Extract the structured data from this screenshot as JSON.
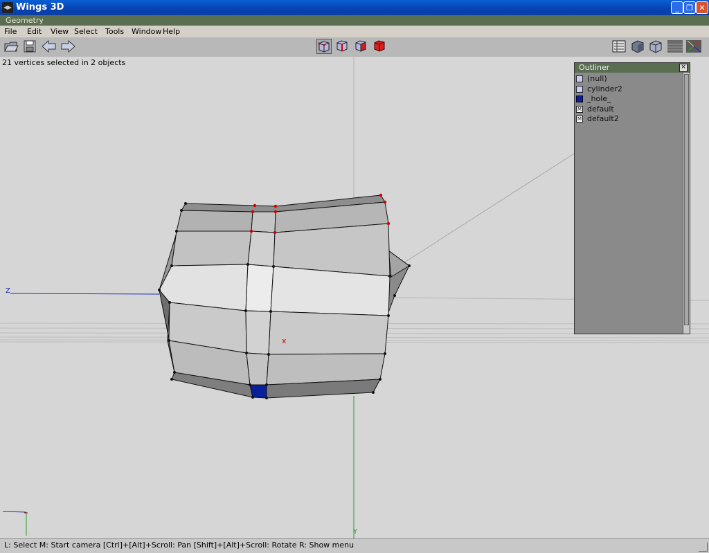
{
  "window": {
    "title": "Wings 3D",
    "minimize": "_",
    "restore": "❐",
    "close": "✕"
  },
  "geometry_tab": "Geometry",
  "menu": [
    "File",
    "Edit",
    "View",
    "Select",
    "Tools",
    "Window",
    "Help"
  ],
  "toolbar": {
    "left": [
      "open-icon",
      "save-icon",
      "undo-icon",
      "redo-icon"
    ],
    "select_modes": [
      "vertex-mode-icon",
      "edge-mode-icon",
      "face-mode-icon",
      "body-mode-icon"
    ],
    "right": [
      "workmode-icon",
      "smooth-shade-icon",
      "flat-shade-icon",
      "ground-grid-icon",
      "axes-icon"
    ]
  },
  "viewport": {
    "status": "21 vertices selected in 2 objects",
    "axis_z_label": "Z",
    "axis_y_label": "Y",
    "origin_marker": "x",
    "colors": {
      "face": "#bdbdbd",
      "light_face": "#e0e0e0",
      "dark_face": "#7a7a7a",
      "hole_face": "#0a1f9a",
      "selected_vertex": "#cc0000",
      "z_axis": "#1a2ab8",
      "y_axis": "#2a9a2a"
    }
  },
  "outliner": {
    "title": "Outliner",
    "close": "×",
    "items": [
      {
        "label": "(null)",
        "icon": "object-cube-icon"
      },
      {
        "label": "cylinder2",
        "icon": "object-cube-icon"
      },
      {
        "label": "_hole_",
        "icon": "hole-material-icon"
      },
      {
        "label": "default",
        "icon": "material-icon"
      },
      {
        "label": "default2",
        "icon": "material-icon"
      }
    ]
  },
  "statusbar": "L: Select   M: Start camera   [Ctrl]+[Alt]+Scroll: Pan   [Shift]+[Alt]+Scroll: Rotate   R: Show menu"
}
